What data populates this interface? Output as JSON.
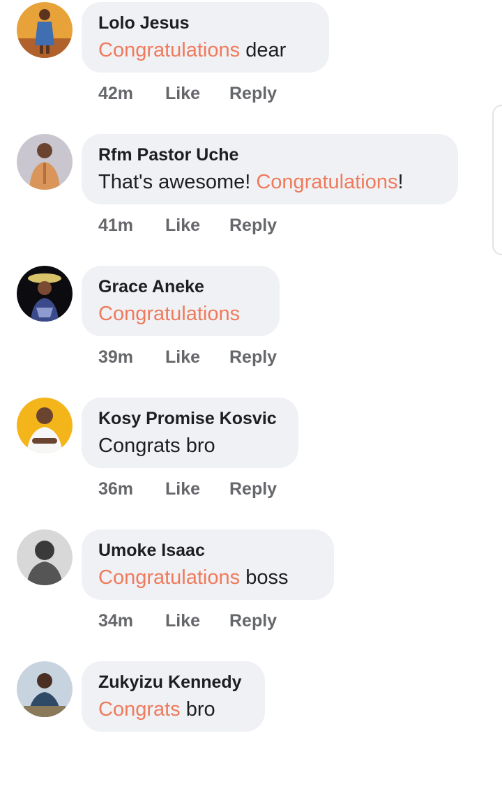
{
  "colors": {
    "highlight": "#ef7a5c",
    "bubble_bg": "#f0f1f4",
    "meta_text": "#65676b"
  },
  "comments": [
    {
      "author": "Lolo Jesus",
      "highlight": "Congratulations",
      "rest": " dear",
      "prefix": "",
      "time": "42m",
      "like_label": "Like",
      "reply_label": "Reply"
    },
    {
      "author": "Rfm Pastor Uche",
      "prefix": "That's awesome! ",
      "highlight": "Congratulations",
      "rest": "!",
      "time": "41m",
      "like_label": "Like",
      "reply_label": "Reply"
    },
    {
      "author": "Grace Aneke",
      "prefix": "",
      "highlight": "Congratulations",
      "rest": "",
      "time": "39m",
      "like_label": "Like",
      "reply_label": "Reply"
    },
    {
      "author": "Kosy Promise Kosvic",
      "prefix": "Congrats bro",
      "highlight": "",
      "rest": "",
      "time": "36m",
      "like_label": "Like",
      "reply_label": "Reply"
    },
    {
      "author": "Umoke Isaac",
      "prefix": "",
      "highlight": "Congratulations",
      "rest": " boss",
      "time": "34m",
      "like_label": "Like",
      "reply_label": "Reply"
    },
    {
      "author": "Zukyizu Kennedy",
      "prefix": "",
      "highlight": "Congrats",
      "rest": " bro",
      "time": "",
      "like_label": "",
      "reply_label": ""
    }
  ]
}
